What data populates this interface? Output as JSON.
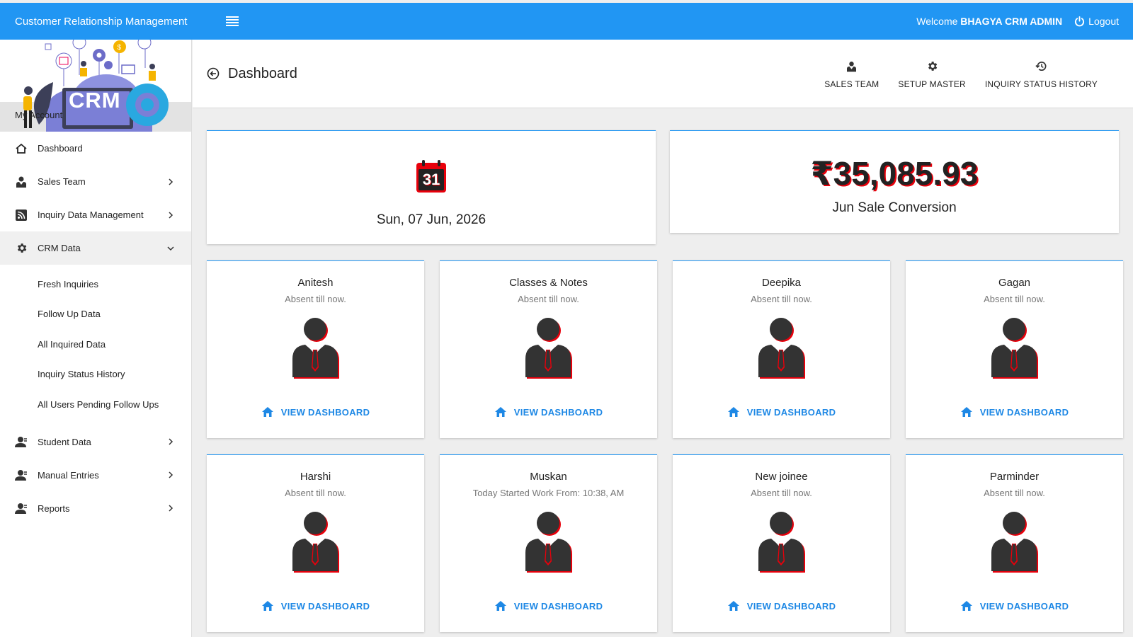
{
  "app": {
    "title": "Customer Relationship Management"
  },
  "header": {
    "welcome_prefix": "Welcome ",
    "user": "BHAGYA CRM ADMIN",
    "logout": "Logout"
  },
  "sidebar": {
    "banner_text": "CRM",
    "account_label": "My Account",
    "items": [
      {
        "label": "Dashboard",
        "icon": "home-icon"
      },
      {
        "label": "Sales Team",
        "icon": "person-tie-icon"
      },
      {
        "label": "Inquiry Data Management",
        "icon": "rss-icon"
      },
      {
        "label": "CRM Data",
        "icon": "gear-icon"
      },
      {
        "label": "Student Data",
        "icon": "user-icon"
      },
      {
        "label": "Manual Entries",
        "icon": "user-icon"
      },
      {
        "label": "Reports",
        "icon": "user-icon"
      }
    ],
    "crm_sub": [
      "Fresh Inquiries",
      "Follow Up Data",
      "All Inquired Data",
      "Inquiry Status History",
      "All Users Pending Follow Ups"
    ]
  },
  "page": {
    "title": "Dashboard",
    "quick": [
      "SALES TEAM",
      "SETUP MASTER",
      "INQUIRY STATUS HISTORY"
    ]
  },
  "stats": {
    "calendar_day": "31",
    "date": "Sun, 07 Jun, 2026",
    "amount": "₹35,085.93",
    "amount_label": "Jun Sale Conversion"
  },
  "view_label": "VIEW DASHBOARD",
  "employees": [
    {
      "name": "Anitesh",
      "status": "Absent till now."
    },
    {
      "name": "Classes & Notes",
      "status": "Absent till now."
    },
    {
      "name": "Deepika",
      "status": "Absent till now."
    },
    {
      "name": "Gagan",
      "status": "Absent till now."
    },
    {
      "name": "Harshi",
      "status": "Absent till now."
    },
    {
      "name": "Muskan",
      "status": "Today Started Work From: 10:38, AM"
    },
    {
      "name": "New joinee",
      "status": "Absent till now."
    },
    {
      "name": "Parminder",
      "status": "Absent till now."
    }
  ],
  "colors": {
    "primary": "#2196f3",
    "accent_red": "#e8000b",
    "link": "#1e88e5"
  }
}
